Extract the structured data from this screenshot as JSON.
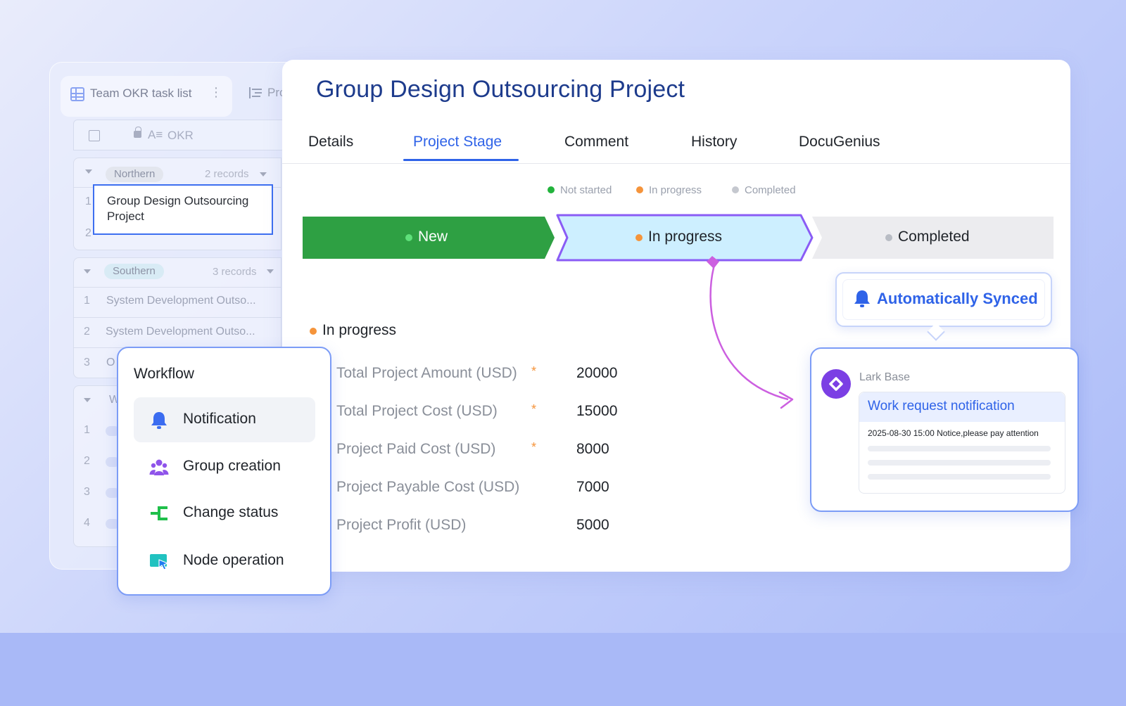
{
  "table_panel": {
    "view_tab": "Team OKR task list",
    "view_tab_2": "Pro",
    "field_header": "OKR",
    "groups": [
      {
        "name": "Northern",
        "count": "2 records",
        "rows": [
          {
            "num": "1",
            "text": "Group Design Outsourcing Project"
          },
          {
            "num": "2",
            "text": ""
          }
        ]
      },
      {
        "name": "Southern",
        "count": "3 records",
        "rows": [
          {
            "num": "1",
            "text": "System Development Outso..."
          },
          {
            "num": "2",
            "text": "System Development Outso..."
          },
          {
            "num": "3",
            "text": "O"
          }
        ]
      },
      {
        "name": "W",
        "count": "",
        "rows": [
          {
            "num": "1",
            "text": ""
          },
          {
            "num": "2",
            "text": ""
          },
          {
            "num": "3",
            "text": ""
          },
          {
            "num": "4",
            "text": ""
          }
        ]
      }
    ]
  },
  "record": {
    "title": "Group Design Outsourcing Project",
    "tabs": [
      {
        "label": "Details"
      },
      {
        "label": "Project Stage",
        "active": true
      },
      {
        "label": "Comment"
      },
      {
        "label": "History"
      },
      {
        "label": "DocuGenius"
      }
    ],
    "legend": [
      {
        "label": "Not started",
        "color": "#22b33c"
      },
      {
        "label": "In progress",
        "color": "#f5943b"
      },
      {
        "label": "Completed",
        "color": "#c5c8cf"
      }
    ],
    "stages": [
      {
        "label": "New",
        "color": "#2ea043",
        "text_color": "#ffffff",
        "dot": "#5fe07a"
      },
      {
        "label": "In progress",
        "color": "#cdefff",
        "text_color": "#1f2329",
        "dot": "#f5943b",
        "border": "#8a5cf5"
      },
      {
        "label": "Completed",
        "color": "#ececef",
        "text_color": "#1f2329",
        "dot": "#b8bcc4"
      }
    ],
    "current_stage": "In progress",
    "fields": [
      {
        "label": "Total Project Amount (USD)",
        "required": "*",
        "value": "20000"
      },
      {
        "label": "Total Project Cost (USD)",
        "required": "*",
        "value": "15000"
      },
      {
        "label": "Project Paid Cost (USD)",
        "required": "*",
        "value": "8000"
      },
      {
        "label": "Project Payable Cost (USD)",
        "required": "",
        "value": "7000"
      },
      {
        "label": "Project Profit (USD)",
        "required": "",
        "value": "5000"
      }
    ]
  },
  "synced": {
    "label": "Automatically Synced",
    "icon": "bell-icon",
    "color": "#2f63e8"
  },
  "notification": {
    "app_name": "Lark Base",
    "title": "Work request notification",
    "body": "2025-08-30 15:00 Notice,please pay attention"
  },
  "workflow": {
    "title": "Workflow",
    "items": [
      {
        "label": "Notification",
        "icon": "bell-icon",
        "highlight": true
      },
      {
        "label": "Group creation",
        "icon": "group-icon"
      },
      {
        "label": "Change status",
        "icon": "status-icon"
      },
      {
        "label": "Node operation",
        "icon": "node-cursor-icon"
      }
    ]
  }
}
